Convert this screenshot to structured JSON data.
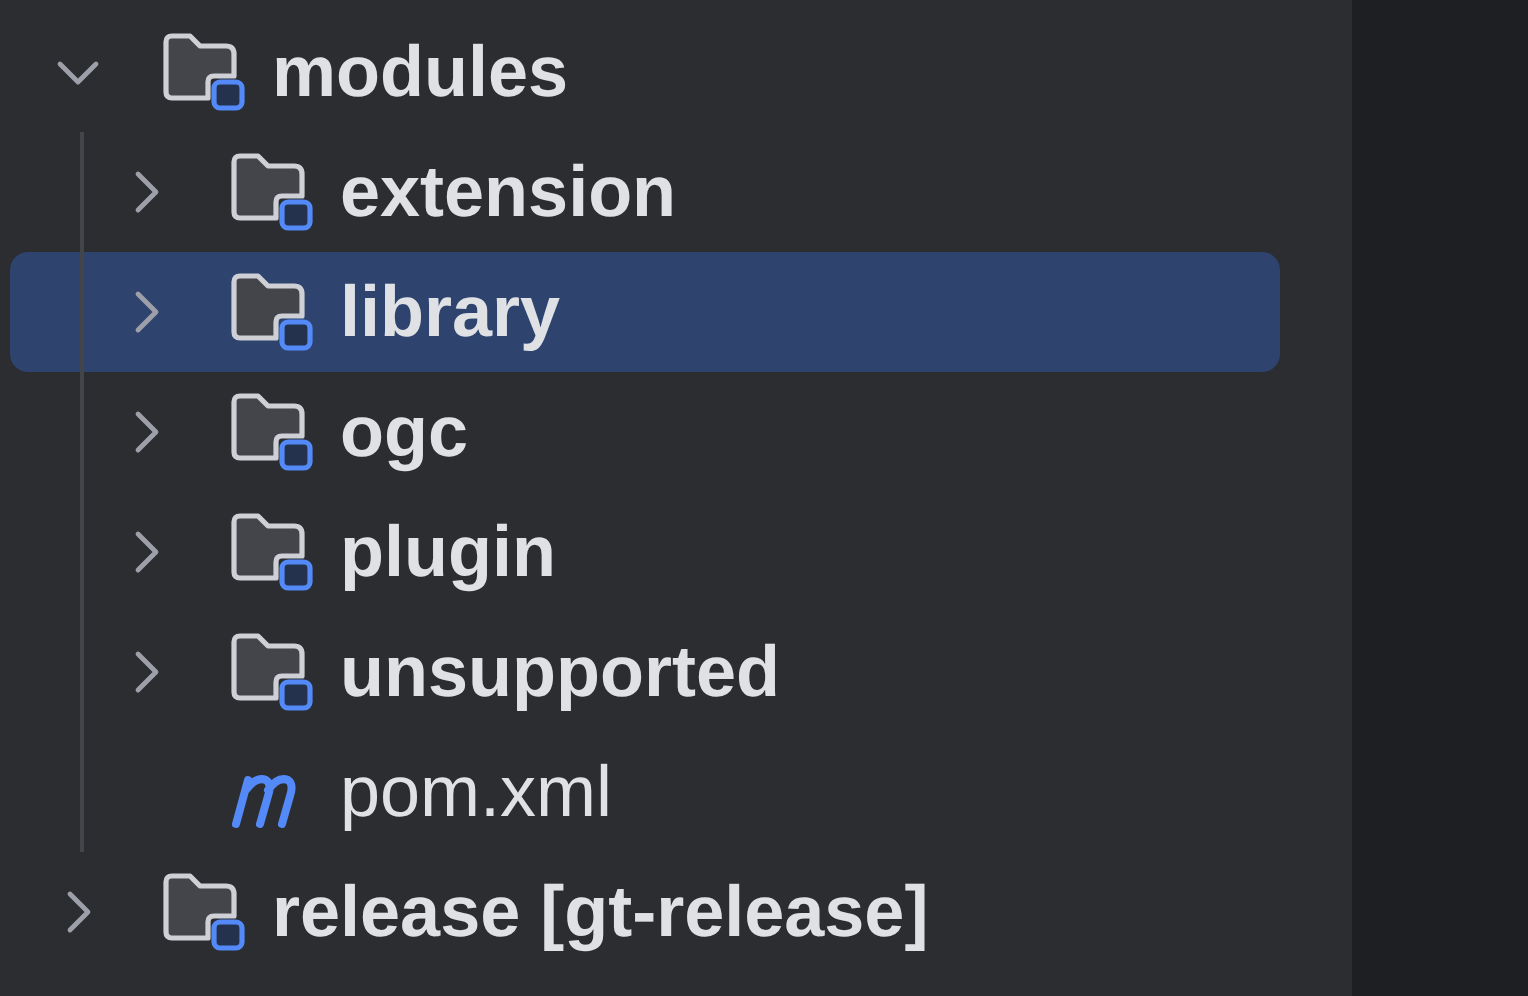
{
  "tree": [
    {
      "label": "modules",
      "kind": "module",
      "expanded": true,
      "selected": false,
      "children": [
        {
          "label": "extension",
          "kind": "module",
          "expanded": false,
          "selected": false
        },
        {
          "label": "library",
          "kind": "module",
          "expanded": false,
          "selected": true
        },
        {
          "label": "ogc",
          "kind": "module",
          "expanded": false,
          "selected": false
        },
        {
          "label": "plugin",
          "kind": "module",
          "expanded": false,
          "selected": false
        },
        {
          "label": "unsupported",
          "kind": "module",
          "expanded": false,
          "selected": false
        },
        {
          "label": "pom.xml",
          "kind": "maven",
          "selected": false
        }
      ]
    },
    {
      "label": "release [gt-release]",
      "kind": "module",
      "expanded": false,
      "selected": false
    }
  ]
}
